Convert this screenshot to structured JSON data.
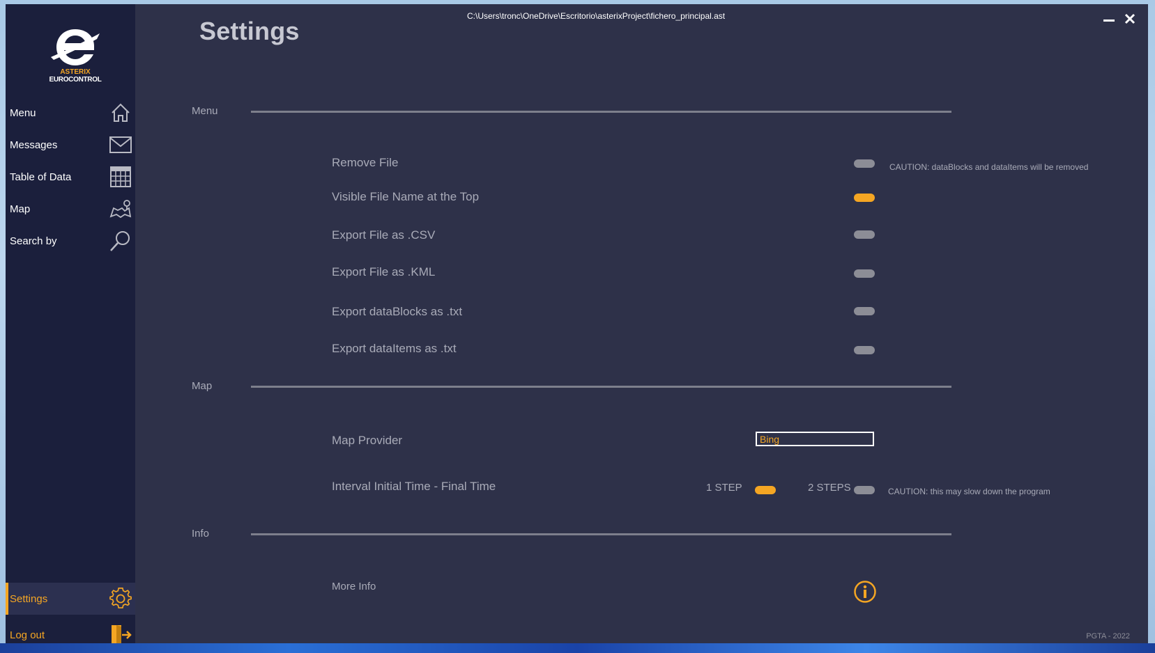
{
  "window": {
    "file_path": "C:\\Users\\tronc\\OneDrive\\Escritorio\\asterixProject\\fichero_principal.ast",
    "minimize_icon": "minimize-icon",
    "close_icon": "close-icon"
  },
  "logo": {
    "line1": "ASTERIX",
    "line2": "EUROCONTROL"
  },
  "sidebar": {
    "items": [
      {
        "label": "Menu",
        "icon": "home-icon"
      },
      {
        "label": "Messages",
        "icon": "envelope-icon"
      },
      {
        "label": "Table of Data",
        "icon": "table-icon"
      },
      {
        "label": "Map",
        "icon": "map-icon"
      },
      {
        "label": "Search by",
        "icon": "search-icon"
      }
    ],
    "settings": {
      "label": "Settings",
      "icon": "gear-icon",
      "active": true
    },
    "logout": {
      "label": "Log out",
      "icon": "logout-icon"
    }
  },
  "page": {
    "title": "Settings"
  },
  "sections": {
    "menu": {
      "label": "Menu",
      "rows": [
        {
          "label": "Remove File",
          "on": false,
          "caution": "CAUTION: dataBlocks and dataItems will be removed"
        },
        {
          "label": "Visible File Name at the Top",
          "on": true
        },
        {
          "label": "Export File as .CSV",
          "on": false
        },
        {
          "label": "Export File as .KML",
          "on": false
        },
        {
          "label": "Export dataBlocks as .txt",
          "on": false
        },
        {
          "label": "Export dataItems as .txt",
          "on": false
        }
      ]
    },
    "map": {
      "label": "Map",
      "provider_label": "Map Provider",
      "provider_value": "Bing",
      "interval_label": "Interval Initial Time - Final Time",
      "step1_label": "1 STEP",
      "step1_on": true,
      "step2_label": "2 STEPS",
      "step2_on": false,
      "interval_caution": "CAUTION: this may slow down the program"
    },
    "info": {
      "label": "Info",
      "more_info_label": "More Info",
      "icon": "info-icon"
    }
  },
  "footer": "PGTA - 2022",
  "colors": {
    "accent": "#f5a623",
    "sidebar": "#1b1f3c",
    "content": "#2e3149",
    "toggle_off": "#8c8d96"
  }
}
